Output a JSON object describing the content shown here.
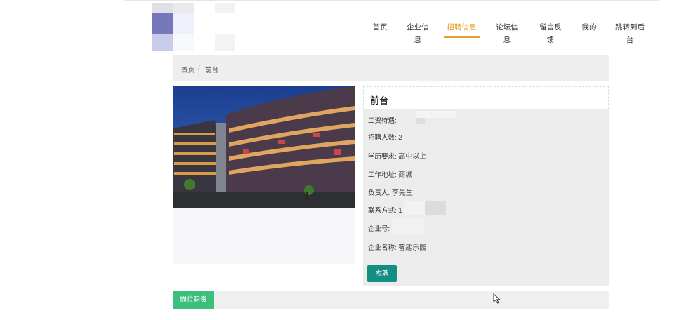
{
  "nav": {
    "items": [
      "首页",
      "企业信息",
      "招聘信息",
      "论坛信息",
      "留言反馈",
      "我的",
      "跳转到后台"
    ],
    "active_index": 2
  },
  "breadcrumb": {
    "home": "首页",
    "separator": "/",
    "current": "前台"
  },
  "job": {
    "title": "前台",
    "salary_label": "工资待遇:",
    "headcount_label": "招聘人数:",
    "headcount": "2",
    "education_label": "学历要求:",
    "education": "高中以上",
    "location_label": "工作地址:",
    "location": "商城",
    "contact_person_label": "负责人:",
    "contact_person": "李先生",
    "phone_label": "联系方式:",
    "phone_visible": "1",
    "company_no_label": "企业号:",
    "company_name_label": "企业名称:",
    "company_name": "智趣乐园",
    "apply_label": "应聘"
  },
  "tabs": {
    "job_duties": "岗位职责"
  },
  "colors": {
    "accent_nav": "#e7a12d",
    "apply_button": "#128e82",
    "tab_active": "#3bbf7b"
  }
}
